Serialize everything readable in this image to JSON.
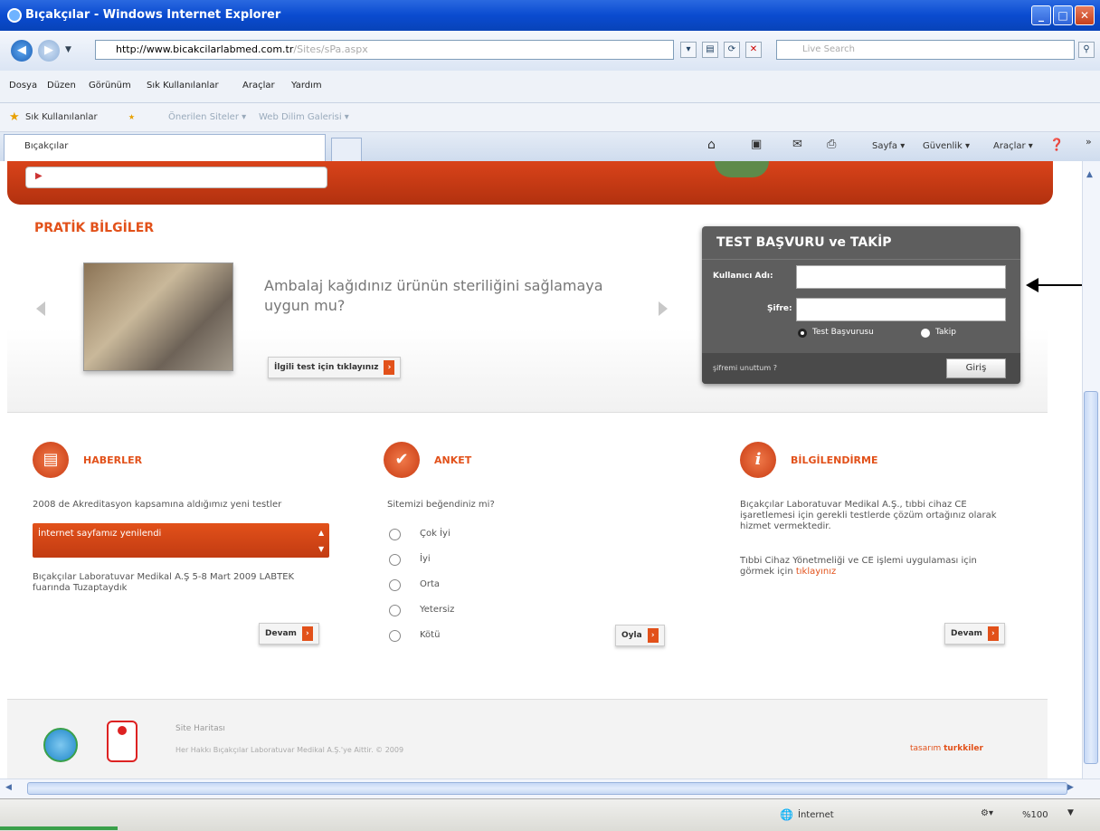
{
  "window": {
    "title": "Bıçakçılar - Windows Internet Explorer"
  },
  "address": {
    "url_main": "http://www.bicakcilarlabmed.com.tr",
    "url_rest": "/Sites/sPa.aspx"
  },
  "search": {
    "placeholder": "Live Search"
  },
  "menu": [
    "Dosya",
    "Düzen",
    "Görünüm",
    "Sık Kullanılanlar",
    "Araçlar",
    "Yardım"
  ],
  "favorites": {
    "label": "Sık Kullanılanlar",
    "items": [
      "Önerilen Siteler ▾",
      "Web Dilim Galerisi ▾"
    ]
  },
  "tab": {
    "label": "Bıçakçılar"
  },
  "command_bar": [
    "Sayfa ▾",
    "Güvenlik ▾",
    "Araçlar ▾"
  ],
  "pratik": {
    "heading": "PRATİK BİLGİLER",
    "text": "Ambalaj kağıdınız ürünün steriliğini sağlamaya uygun mu?",
    "link": "İlgili test için tıklayınız"
  },
  "login": {
    "title": "TEST BAŞVURU ve TAKİP",
    "user_label": "Kullanıcı Adı:",
    "password_label": "Şifre:",
    "option1": "Test Başvurusu",
    "option2": "Takip",
    "forgot": "şifremi unuttum ?",
    "submit": "Giriş"
  },
  "haberler": {
    "title": "HABERLER",
    "item1": "2008 de Akreditasyon kapsamına aldığımız yeni testler",
    "highlight": "İnternet sayfamız yenilendi",
    "item2": "Bıçakçılar Laboratuvar Medikal A.Ş 5-8 Mart 2009 LABTEK fuarında Tuzaptaydık",
    "button": "Devam"
  },
  "anket": {
    "title": "ANKET",
    "question": "Sitemizi beğendiniz mi?",
    "options": [
      "Çok İyi",
      "İyi",
      "Orta",
      "Yetersiz",
      "Kötü"
    ],
    "button": "Oyla"
  },
  "bilgi": {
    "title": "BİLGİLENDİRME",
    "p1": "Bıçakçılar Laboratuvar Medikal A.Ş., tıbbi cihaz CE işaretlemesi için gerekli testlerde çözüm ortağınız olarak hizmet vermektedir.",
    "p2a": "Tıbbi Cihaz Yönetmeliği ve CE işlemi uygulaması için görmek için ",
    "p2link": "tıklayınız",
    "button": "Devam"
  },
  "footer": {
    "sitemap": "Site Haritası",
    "copyright": "Her Hakkı Bıçakçılar Laboratuvar Medikal A.Ş.'ye Aittir. © 2009",
    "brand_a": "tasarım",
    "brand_b": "turkkiler"
  },
  "status": {
    "zone": "İnternet",
    "zoom": "%100"
  },
  "colors": {
    "accent": "#e2511a",
    "login_bg": "#5e5e5e",
    "titlebar": "#0a4bd0"
  }
}
